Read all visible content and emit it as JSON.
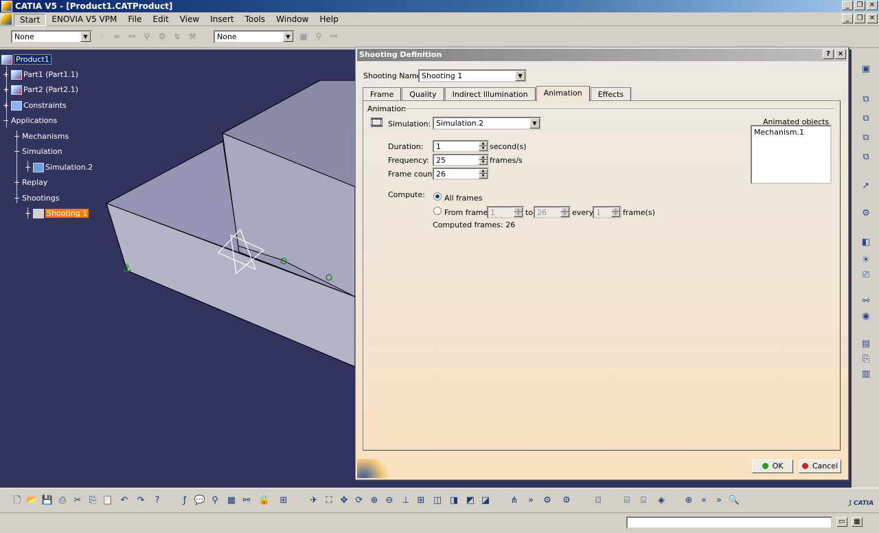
{
  "window": {
    "title": "CATIA V5 - [Product1.CATProduct]"
  },
  "menubar": {
    "items": [
      "Start",
      "ENOVIA V5 VPM",
      "File",
      "Edit",
      "View",
      "Insert",
      "Tools",
      "Window",
      "Help"
    ]
  },
  "toolbar": {
    "combo1_value": "None",
    "combo2_value": "None"
  },
  "tree": {
    "root": "Product1",
    "part1": "Part1 (Part1.1)",
    "part2": "Part2 (Part2.1)",
    "constraints": "Constraints",
    "applications": "Applications",
    "mechanisms": "Mechanisms",
    "simulation": "Simulation",
    "simulation2": "Simulation.2",
    "replay": "Replay",
    "shootings": "Shootings",
    "shooting1": "Shooting 1"
  },
  "dialog": {
    "title": "Shooting Definition",
    "help_btn": "?",
    "close_btn": "×",
    "shooting_name_label": "Shooting Name:",
    "shooting_name_value": "Shooting 1",
    "tabs": [
      "Frame",
      "Quality",
      "Indirect Illumination",
      "Animation",
      "Effects"
    ],
    "active_tab": "Animation",
    "group_label": "Animation",
    "simulation_label": "Simulation:",
    "simulation_value": "Simulation.2",
    "duration_label": "Duration:",
    "duration_value": "1",
    "duration_unit": "second(s)",
    "frequency_label": "Frequency:",
    "frequency_value": "25",
    "frequency_unit": "frames/s",
    "frame_count_label": "Frame count:",
    "frame_count_value": "26",
    "compute_label": "Compute:",
    "all_frames_label": "All frames",
    "from_frame_label": "From frame",
    "from_value": "1",
    "to_label": "to",
    "to_value": "26",
    "every_label": "every",
    "every_value": "1",
    "frames_unit": "frame(s)",
    "computed_frames": "Computed frames: 26",
    "animated_objects_label": "Animated objects",
    "animated_objects": [
      "Mechanism.1"
    ],
    "ok_label": "OK",
    "cancel_label": "Cancel"
  },
  "colors": {
    "viewport_bg": "#33335f",
    "title_blue": "#0a246a",
    "selection_orange": "#f07c1a",
    "ok_green": "#2a9a2a",
    "cancel_red": "#cc2222"
  }
}
